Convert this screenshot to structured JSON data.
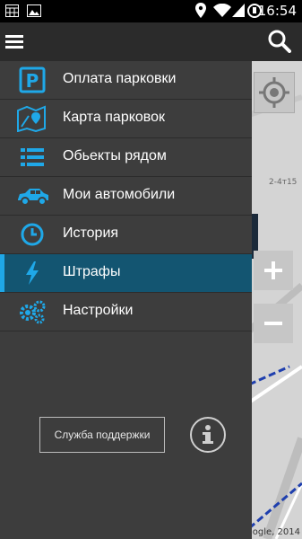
{
  "status_bar": {
    "time": "16:54"
  },
  "drawer": {
    "items": [
      {
        "label": "Оплата парковки",
        "icon": "parking-icon"
      },
      {
        "label": "Карта парковок",
        "icon": "map-icon"
      },
      {
        "label": "Обьекты рядом",
        "icon": "list-icon"
      },
      {
        "label": "Мои автомобили",
        "icon": "car-icon"
      },
      {
        "label": "История",
        "icon": "clock-icon"
      },
      {
        "label": "Штрафы",
        "icon": "lightning-icon",
        "active": true
      },
      {
        "label": "Настройки",
        "icon": "gears-icon"
      }
    ],
    "support_label": "Служба поддержки"
  },
  "map": {
    "distance_label": "2-4т15",
    "attribution": "ogle, 2014"
  },
  "colors": {
    "accent": "#1fa8e8",
    "active_bg": "#135571",
    "drawer_bg": "#3d3d3d",
    "actionbar_bg": "#2b2b2b"
  }
}
